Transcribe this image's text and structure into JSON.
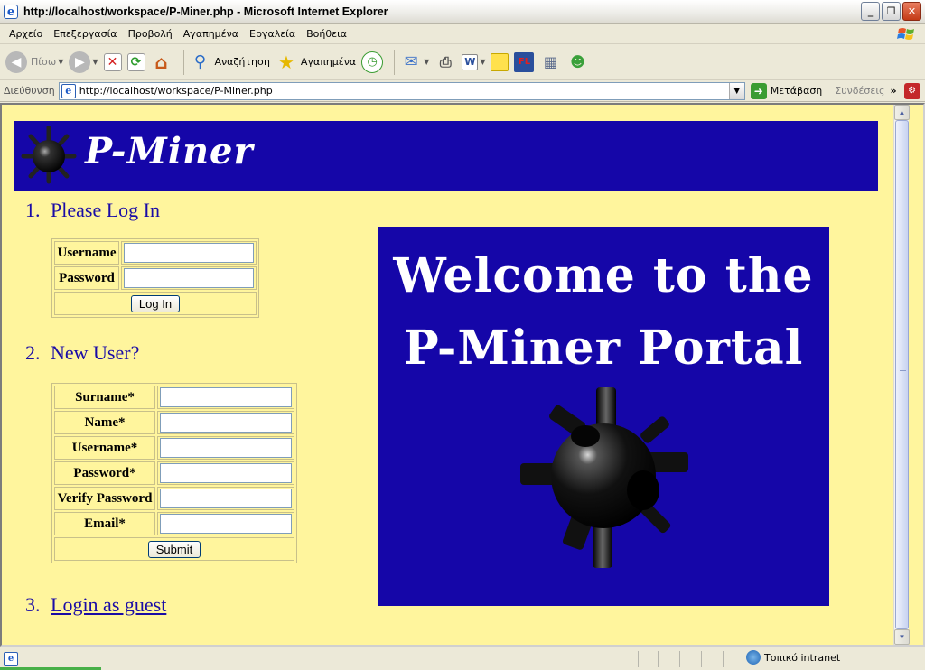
{
  "window": {
    "title": "http://localhost/workspace/P-Miner.php - Microsoft Internet Explorer",
    "min_glyph": "_",
    "max_glyph": "❐",
    "close_glyph": "✕"
  },
  "menu": [
    "Αρχείο",
    "Επεξεργασία",
    "Προβολή",
    "Αγαπημένα",
    "Εργαλεία",
    "Βοήθεια"
  ],
  "toolbar": {
    "back_label": "Πίσω",
    "search_label": "Αναζήτηση",
    "favorites_label": "Αγαπημένα",
    "icons": [
      "back-icon",
      "forward-icon",
      "stop-icon",
      "refresh-icon",
      "home-icon",
      "search-icon",
      "favorites-icon",
      "history-icon",
      "mail-icon",
      "print-icon",
      "edit-icon",
      "notes-icon",
      "flash-icon",
      "research-icon",
      "messenger-icon"
    ]
  },
  "address": {
    "label": "Διεύθυνση",
    "url": "http://localhost/workspace/P-Miner.php",
    "go_label": "Μετάβαση",
    "links_label": "Συνδέσεις",
    "chevron": "»"
  },
  "page": {
    "banner_title": "P-Miner",
    "section1": {
      "number": "1.",
      "title": "Please Log In"
    },
    "login": {
      "username_label": "Username",
      "password_label": "Password",
      "submit_label": "Log In"
    },
    "section2": {
      "number": "2.",
      "title": "New User?"
    },
    "register": {
      "surname_label": "Surname*",
      "name_label": "Name*",
      "username_label": "Username*",
      "password_label": "Password*",
      "verify_label": "Verify Password",
      "email_label": "Email*",
      "submit_label": "Submit"
    },
    "section3": {
      "number": "3.",
      "link": "Login as guest"
    },
    "welcome_line1": "Welcome to the",
    "welcome_line2": "P-Miner Portal"
  },
  "status": {
    "zone_label": "Τοπικό intranet"
  },
  "colors": {
    "page_background": "#fff59d",
    "banner_blue": "#1506a8",
    "heading_blue": "#1a0ca6"
  }
}
